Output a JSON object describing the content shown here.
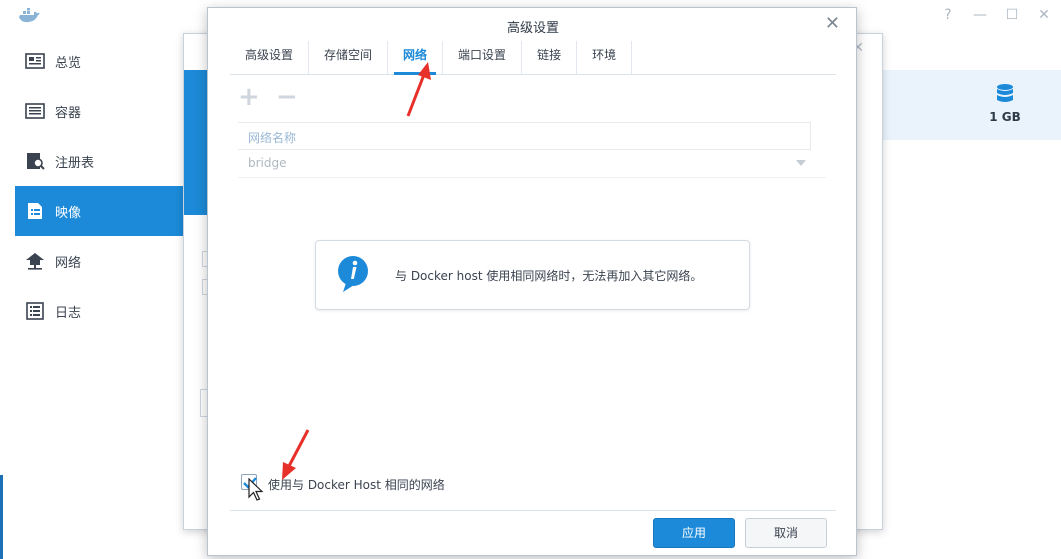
{
  "sidebar": {
    "items": [
      {
        "label": "总览",
        "icon": "overview-icon"
      },
      {
        "label": "容器",
        "icon": "container-icon"
      },
      {
        "label": "注册表",
        "icon": "registry-icon"
      },
      {
        "label": "映像",
        "icon": "image-icon",
        "active": true
      },
      {
        "label": "网络",
        "icon": "network-icon"
      },
      {
        "label": "日志",
        "icon": "log-icon"
      }
    ]
  },
  "header": {
    "window_controls": [
      "?",
      "—",
      "☐",
      "✕"
    ]
  },
  "storage": {
    "label": "1 GB"
  },
  "dialog": {
    "title": "高级设置",
    "close": "✕",
    "tabs": [
      {
        "label": "高级设置"
      },
      {
        "label": "存储空间"
      },
      {
        "label": "网络",
        "active": true
      },
      {
        "label": "端口设置"
      },
      {
        "label": "链接"
      },
      {
        "label": "环境"
      }
    ],
    "toolbar": {
      "add": "+",
      "remove": "−"
    },
    "grid": {
      "column_header": "网络名称",
      "row_value": "bridge"
    },
    "info_message": "与 Docker host 使用相同网络时，无法再加入其它网络。",
    "checkbox": {
      "label": "使用与 Docker Host 相同的网络",
      "checked": true
    },
    "buttons": {
      "apply": "应用",
      "cancel": "取消"
    }
  },
  "colors": {
    "accent": "#1c8ad8",
    "annotation_arrow": "#e8302a"
  }
}
